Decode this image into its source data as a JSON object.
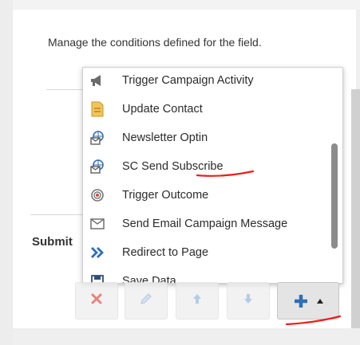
{
  "description": "Manage the conditions defined for the field.",
  "section_title": "Submit",
  "menu": {
    "items": [
      {
        "label": "Trigger Campaign Activity",
        "icon": "megaphone-icon"
      },
      {
        "label": "Update Contact",
        "icon": "contact-card-icon"
      },
      {
        "label": "Newsletter Optin",
        "icon": "envelope-globe-icon"
      },
      {
        "label": "SC Send Subscribe",
        "icon": "envelope-globe-icon"
      },
      {
        "label": "Trigger Outcome",
        "icon": "target-icon"
      },
      {
        "label": "Send Email Campaign Message",
        "icon": "envelope-icon"
      },
      {
        "label": "Redirect to Page",
        "icon": "double-chevron-right-icon"
      },
      {
        "label": "Save Data",
        "icon": "save-icon"
      }
    ]
  },
  "toolbar": {
    "buttons": [
      {
        "name": "delete",
        "icon": "x-icon",
        "color": "#e05a4e"
      },
      {
        "name": "edit",
        "icon": "pencil-icon",
        "color": "#9bbbe0"
      },
      {
        "name": "move-up",
        "icon": "arrow-up-icon",
        "color": "#9bbbe0"
      },
      {
        "name": "move-down",
        "icon": "arrow-down-icon",
        "color": "#9bbbe0"
      },
      {
        "name": "add",
        "icon": "plus-icon",
        "color": "#2e6fb5"
      }
    ]
  },
  "annotation_color": "#e8201a"
}
